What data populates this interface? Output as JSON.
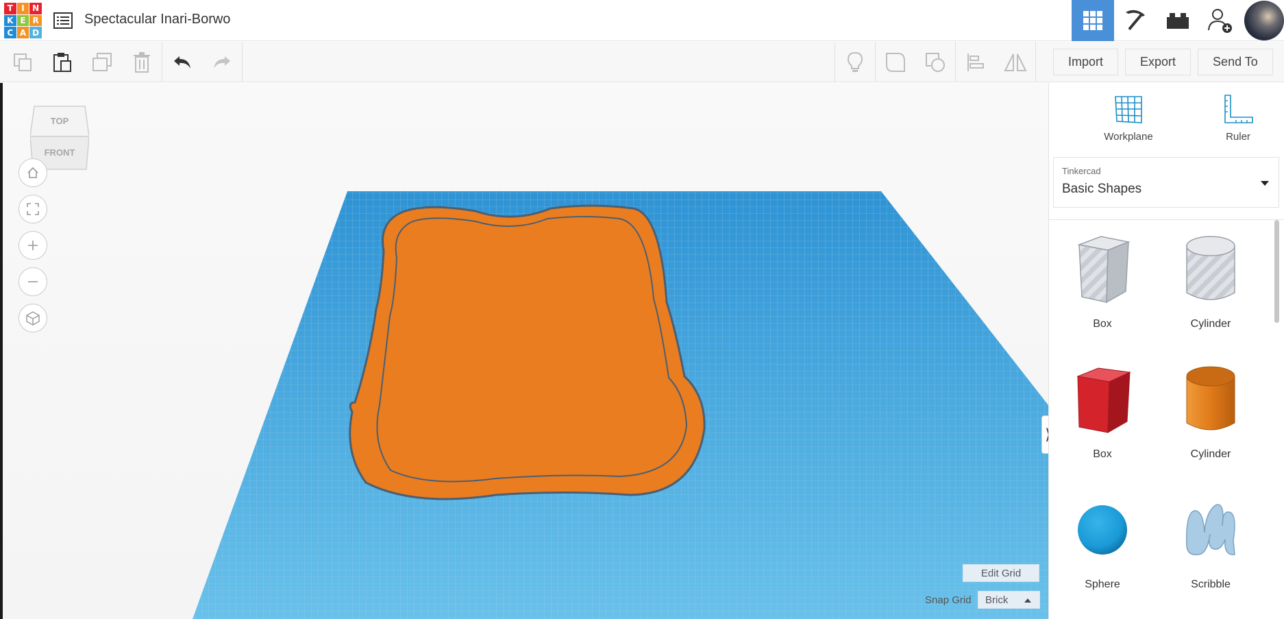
{
  "logo": {
    "letters": [
      "T",
      "I",
      "N",
      "K",
      "E",
      "R",
      "C",
      "A",
      "D"
    ],
    "colors": [
      "#e8222d",
      "#f49224",
      "#e8222d",
      "#1f8dd6",
      "#8dc63f",
      "#f49224",
      "#1f8dd6",
      "#f49224",
      "#4fb3e0"
    ]
  },
  "header": {
    "title": "Spectacular Inari-Borwo",
    "icons": [
      "design-list-icon",
      "grid-view-icon",
      "pickaxe-icon",
      "bricks-icon",
      "add-user-icon"
    ]
  },
  "toolbar": {
    "left_icons": [
      "copy-icon",
      "paste-icon",
      "duplicate-icon",
      "trash-icon",
      "undo-icon",
      "redo-icon"
    ],
    "right_icons": [
      "lightbulb-icon",
      "group-icon",
      "ungroup-icon",
      "align-icon",
      "mirror-icon"
    ],
    "import_label": "Import",
    "export_label": "Export",
    "send_to_label": "Send To"
  },
  "viewcube": {
    "top_label": "TOP",
    "front_label": "FRONT"
  },
  "nav_controls": [
    "home-icon",
    "fit-view-icon",
    "zoom-in-icon",
    "zoom-out-icon",
    "perspective-icon"
  ],
  "grid": {
    "edit_label": "Edit Grid",
    "snap_label": "Snap Grid",
    "snap_value": "Brick"
  },
  "panel": {
    "workplane_label": "Workplane",
    "ruler_label": "Ruler",
    "library_category": "Tinkercad",
    "library_value": "Basic Shapes",
    "shapes": [
      {
        "label": "Box",
        "style": "hole"
      },
      {
        "label": "Cylinder",
        "style": "hole"
      },
      {
        "label": "Box",
        "style": "solid"
      },
      {
        "label": "Cylinder",
        "style": "solid"
      },
      {
        "label": "Sphere",
        "style": "solid"
      },
      {
        "label": "Scribble",
        "style": "solid"
      }
    ]
  },
  "colors": {
    "accent": "#4a90d9",
    "workplane": "#5cb8e6",
    "object": "#ea7d20",
    "box_red": "#d5232c",
    "cylinder_orange": "#e07a1a",
    "sphere_blue": "#1a9ad6"
  }
}
